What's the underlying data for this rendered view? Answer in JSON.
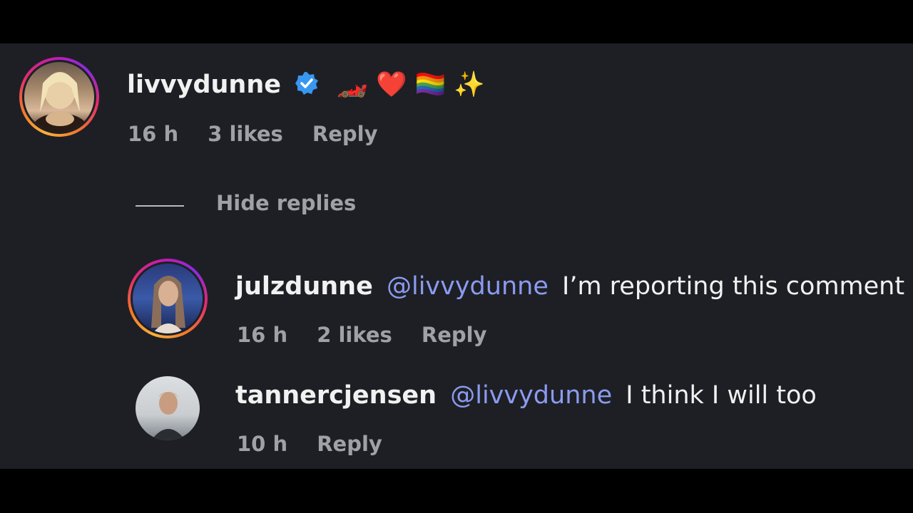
{
  "comments": [
    {
      "username": "livvydunne",
      "verified": true,
      "text": "🏎️ ❤️ 🏳️‍🌈 ✨",
      "time": "16 h",
      "likes": "3 likes",
      "reply_label": "Reply"
    }
  ],
  "thread": {
    "hide_replies_label": "Hide replies"
  },
  "replies": [
    {
      "username": "julzdunne",
      "mention": "@livvydunne",
      "text": "I’m reporting this comment",
      "time": "16 h",
      "likes": "2 likes",
      "reply_label": "Reply"
    },
    {
      "username": "tannercjensen",
      "mention": "@livvydunne",
      "text": "I think I will too",
      "time": "10 h",
      "reply_label": "Reply"
    }
  ],
  "colors": {
    "background": "#1e1f24",
    "letterbox": "#000000",
    "mention": "#8a9bf0",
    "meta": "#a0a0a6",
    "verified": "#3897f0"
  }
}
